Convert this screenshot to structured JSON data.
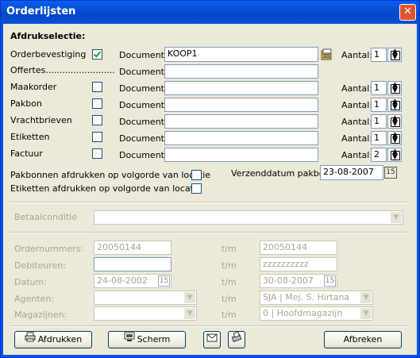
{
  "window": {
    "title": "Orderlijsten",
    "close_label": "✕"
  },
  "section_title": "Afdrukselectie:",
  "rows": [
    {
      "label": "Orderbevestiging",
      "checked": true,
      "doc_label": "Document:",
      "doc_value": "KOOP1",
      "aantal_label": "Aantal:",
      "aantal": "1"
    },
    {
      "label": "Offertes.........................",
      "checked": false,
      "doc_label": "Document:",
      "doc_value": "",
      "aantal_label": "",
      "aantal": ""
    },
    {
      "label": "Maakorder",
      "checked": false,
      "doc_label": "Document:",
      "doc_value": "",
      "aantal_label": "Aantal:",
      "aantal": "1"
    },
    {
      "label": "Pakbon",
      "checked": false,
      "doc_label": "Document:",
      "doc_value": "",
      "aantal_label": "Aantal:",
      "aantal": "1"
    },
    {
      "label": "Vrachtbrieven",
      "checked": false,
      "doc_label": "Document:",
      "doc_value": "",
      "aantal_label": "Aantal:",
      "aantal": "1"
    },
    {
      "label": "Etiketten",
      "checked": false,
      "doc_label": "Document:",
      "doc_value": "",
      "aantal_label": "Aantal:",
      "aantal": "1"
    },
    {
      "label": "Factuur",
      "checked": false,
      "doc_label": "Document:",
      "doc_value": "",
      "aantal_label": "Aantal:",
      "aantal": "2"
    }
  ],
  "options": {
    "pakbon_order": "Pakbonnen afdrukken op volgorde van locatie",
    "etiketten_order": "Etiketten afdrukken op volgorde van locatie",
    "verzenddatum_label": "Verzenddatum pakbon:",
    "verzenddatum": "23-08-2007"
  },
  "filters": {
    "betaalconditie_label": "Betaalconditie",
    "tm_label": "t/m",
    "ordernummers_label": "Ordernummers:",
    "ordernummers_from": "20050144",
    "ordernummers_to": "20050144",
    "debiteuren_label": "Debiteuren:",
    "debiteuren_from": "",
    "debiteuren_to": "zzzzzzzzzz",
    "datum_label": "Datum:",
    "datum_from": "24-08-2002",
    "datum_to": "30-08-2007",
    "agenten_label": "Agenten:",
    "agenten_to": "SJA | Mej. S. Hirtana",
    "magazijnen_label": "Magazijnen:",
    "magazijnen_to": "0 | Hoofdmagazijn"
  },
  "buttons": {
    "afdrukken": "Afdrukken",
    "scherm": "Scherm",
    "afbreken": "Afbreken"
  }
}
